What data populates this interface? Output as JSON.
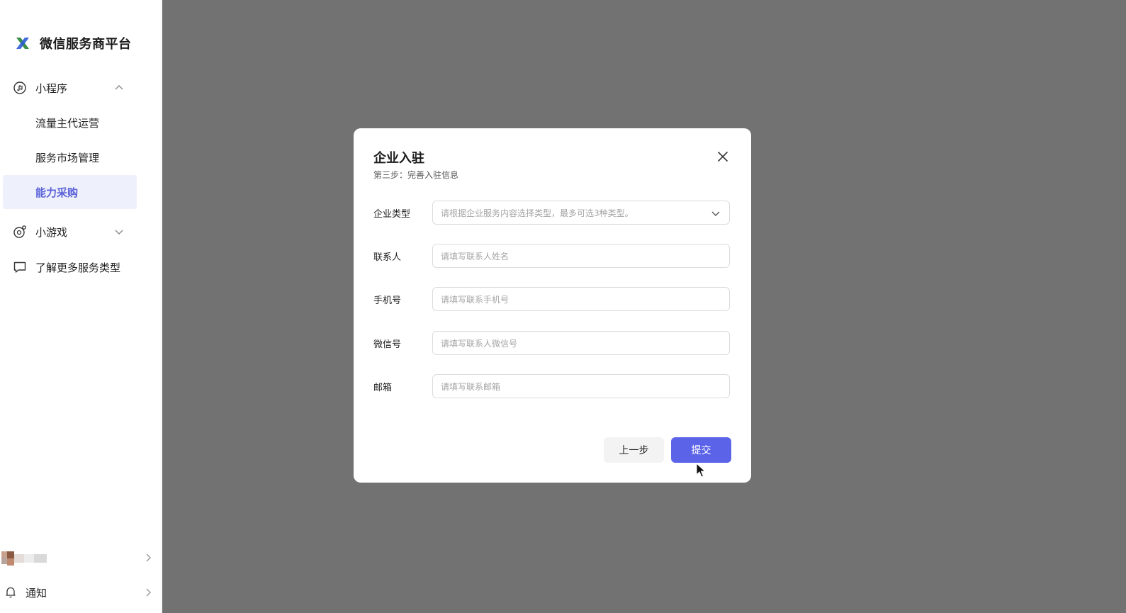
{
  "sidebar": {
    "brand_title": "微信服务商平台",
    "groups": [
      {
        "label": "小程序",
        "icon": "mini-program-icon",
        "expanded": true,
        "items": [
          {
            "label": "流量主代运营",
            "active": false
          },
          {
            "label": "服务市场管理",
            "active": false
          },
          {
            "label": "能力采购",
            "active": true
          }
        ]
      },
      {
        "label": "小游戏",
        "icon": "mini-game-icon",
        "expanded": false
      },
      {
        "label": "了解更多服务类型",
        "icon": "chat-bubble-icon"
      }
    ],
    "notice_label": "通知"
  },
  "modal": {
    "title": "企业入驻",
    "subtitle": "第三步：完善入驻信息",
    "fields": [
      {
        "label": "企业类型",
        "placeholder": "请根据企业服务内容选择类型，最多可选3种类型。",
        "type": "select"
      },
      {
        "label": "联系人",
        "placeholder": "请填写联系人姓名",
        "type": "text"
      },
      {
        "label": "手机号",
        "placeholder": "请填写联系手机号",
        "type": "text"
      },
      {
        "label": "微信号",
        "placeholder": "请填写联系人微信号",
        "type": "text"
      },
      {
        "label": "邮箱",
        "placeholder": "请填写联系邮箱",
        "type": "text"
      }
    ],
    "prev_label": "上一步",
    "submit_label": "提交"
  },
  "colors": {
    "accent": "#5b63e8",
    "active_bg": "#eef0fb",
    "overlay": "#727272"
  }
}
